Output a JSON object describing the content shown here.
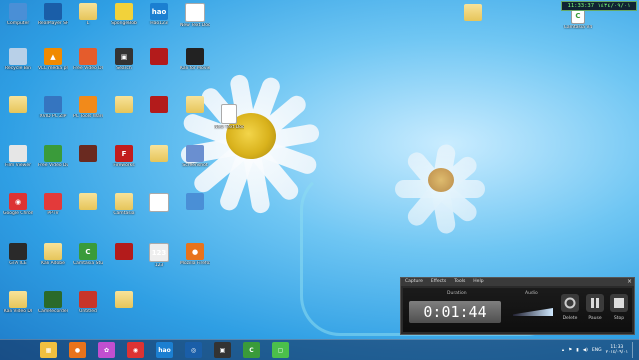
{
  "desktop": {
    "icons_left": [
      {
        "label": "Computer",
        "kind": "computer"
      },
      {
        "label": "RealPlayer SP",
        "kind": "real"
      },
      {
        "label": "L",
        "kind": "folder"
      },
      {
        "label": "SpongeBob",
        "kind": "sponge"
      },
      {
        "label": "Hao123",
        "kind": "hao"
      },
      {
        "label": "New Text Document",
        "kind": "doc"
      },
      {
        "label": "Recycle Bin",
        "kind": "bin"
      },
      {
        "label": "VLC media player",
        "kind": "vlc"
      },
      {
        "label": "Free Video Dl",
        "kind": "freevid"
      },
      {
        "label": "Search",
        "kind": "search"
      },
      {
        "label": "",
        "kind": "film"
      },
      {
        "label": "Kali for Movie",
        "kind": "movie"
      },
      {
        "label": "",
        "kind": "folder"
      },
      {
        "label": "XVID PC ZIP",
        "kind": "gear"
      },
      {
        "label": "PC Tools Ware",
        "kind": "pctools"
      },
      {
        "label": "",
        "kind": "folder"
      },
      {
        "label": "",
        "kind": "film"
      },
      {
        "label": "",
        "kind": "folder"
      },
      {
        "label": "Film Viewer",
        "kind": "reel"
      },
      {
        "label": "Free Video Dub",
        "kind": "dub"
      },
      {
        "label": "",
        "kind": "movie2"
      },
      {
        "label": "Fireworks",
        "kind": "flash"
      },
      {
        "label": "",
        "kind": "folder"
      },
      {
        "label": "Screenshot",
        "kind": "screenshot"
      },
      {
        "label": "Google Chrome",
        "kind": "chrome"
      },
      {
        "label": "PPTV",
        "kind": "pptv"
      },
      {
        "label": "",
        "kind": "folder"
      },
      {
        "label": "Camtasia",
        "kind": "folder"
      },
      {
        "label": "",
        "kind": "doc2"
      },
      {
        "label": "",
        "kind": "pc"
      },
      {
        "label": "GTA ICE",
        "kind": "gta"
      },
      {
        "label": "Kali Adobe",
        "kind": "folder"
      },
      {
        "label": "Camtasia Studio 8",
        "kind": "camtasia"
      },
      {
        "label": "",
        "kind": "film"
      },
      {
        "label": "123",
        "kind": "doc3"
      },
      {
        "label": "Mozilla Firefox",
        "kind": "firefox"
      },
      {
        "label": "Kali Video Dl",
        "kind": "folder"
      },
      {
        "label": "CamRecorder 8",
        "kind": "camrec"
      },
      {
        "label": "Untitled",
        "kind": "untitled"
      },
      {
        "label": "",
        "kind": "folder"
      }
    ],
    "floating_doc": {
      "label": "New Text Document"
    },
    "top_right": [
      {
        "label": "",
        "kind": "folder"
      },
      {
        "label": "Camtasia V4",
        "kind": "camtasia_small"
      }
    ]
  },
  "clock_badge": {
    "text": "11:33:37  ١٤٣٤/٠٩/٠١"
  },
  "recorder": {
    "menu": [
      "Capture",
      "Effects",
      "Tools",
      "Help"
    ],
    "close": "×",
    "duration_label": "Duration",
    "duration": "0:01:44",
    "audio_label": "Audio",
    "buttons": [
      {
        "label": "Delete",
        "icon": "delete-icon"
      },
      {
        "label": "Pause",
        "icon": "pause-icon"
      },
      {
        "label": "Stop",
        "icon": "stop-icon"
      }
    ]
  },
  "taskbar": {
    "apps": [
      {
        "name": "windows-explorer",
        "glyph": "▦",
        "color": "#f0c040"
      },
      {
        "name": "firefox",
        "glyph": "●",
        "color": "#e8731c"
      },
      {
        "name": "picasa",
        "glyph": "✿",
        "color": "#c04fd0"
      },
      {
        "name": "chrome",
        "glyph": "◉",
        "color": "#d33"
      },
      {
        "name": "hao123",
        "glyph": "hao",
        "color": "#1b7fd1"
      },
      {
        "name": "realplayer",
        "glyph": "◎",
        "color": "#1a5ea8"
      },
      {
        "name": "search",
        "glyph": "▣",
        "color": "#333"
      },
      {
        "name": "camtasia",
        "glyph": "C",
        "color": "#3a9b3a"
      },
      {
        "name": "camtasia-recorder",
        "glyph": "▢",
        "color": "#4bbf4b"
      }
    ],
    "tray": {
      "lang": "ENG",
      "time": "11:33",
      "date": "٢٠١٤/٠٩/٠١"
    }
  },
  "colors": {
    "desktop": "#2f9fe4",
    "taskbar": "#14285066",
    "recorder_bg": "#2a2a2a"
  }
}
